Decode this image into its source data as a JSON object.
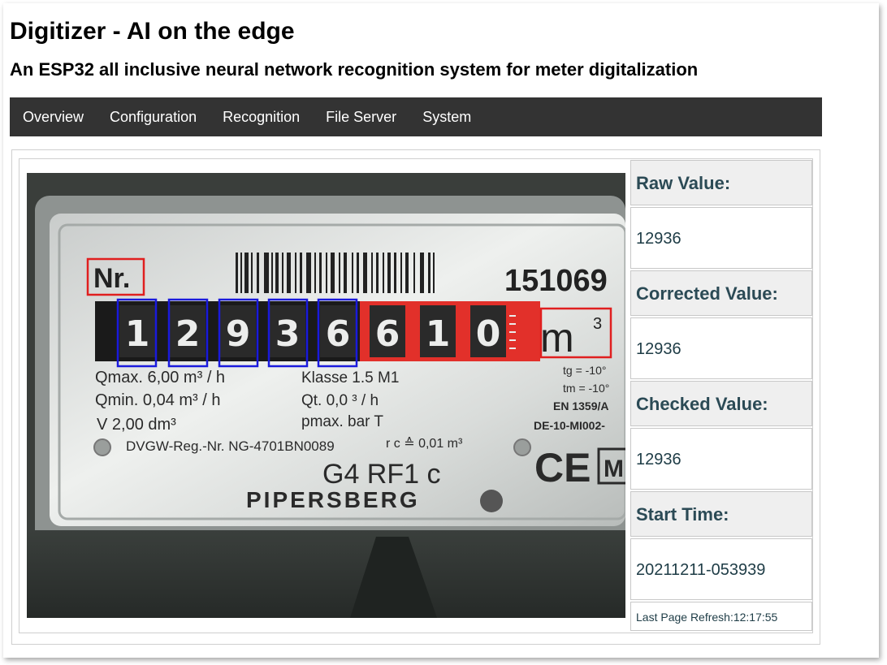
{
  "header": {
    "title": "Digitizer - AI on the edge",
    "subtitle": "An ESP32 all inclusive neural network recognition system for meter digitalization"
  },
  "nav": {
    "items": [
      "Overview",
      "Configuration",
      "Recognition",
      "File Server",
      "System"
    ]
  },
  "meter": {
    "label_nr": "Nr.",
    "serial": "151069",
    "digits": [
      "1",
      "2",
      "9",
      "3",
      "6"
    ],
    "red_digits": [
      "6",
      "1",
      "0"
    ],
    "unit": "m",
    "unit_sup": "3",
    "qmax": "Qmax. 6,00 m³ / h",
    "qmin": "Qmin.  0,04 m³ / h",
    "v": "V       2,00 dm³",
    "klasse": "Klasse  1.5  M1",
    "qt": "Qt.   0,0   ³ / h",
    "pmax": "pmax.       bar  T",
    "tg": "tg = -10°",
    "tm": "tm = -10°",
    "en": "EN 1359/A",
    "de": "DE-10-MI002-",
    "dvgw": "DVGW-Reg.-Nr. NG-4701BN0089",
    "rc": "r c ≙ 0,01 m³",
    "model": "G4 RF1 c",
    "brand": "PIPERSBERG",
    "ce": "CE",
    "m": "M"
  },
  "sidebar": {
    "raw_label": "Raw Value:",
    "raw_value": "12936",
    "corrected_label": "Corrected Value:",
    "corrected_value": "12936",
    "checked_label": "Checked Value:",
    "checked_value": "12936",
    "start_label": "Start Time:",
    "start_value": "20211211-053939",
    "refresh": "Last Page Refresh:12:17:55"
  },
  "colors": {
    "nav_bg": "#333333",
    "roi_digit": "#1a1adc",
    "roi_analog": "#e01f1f",
    "value_text": "#1e3c46"
  }
}
